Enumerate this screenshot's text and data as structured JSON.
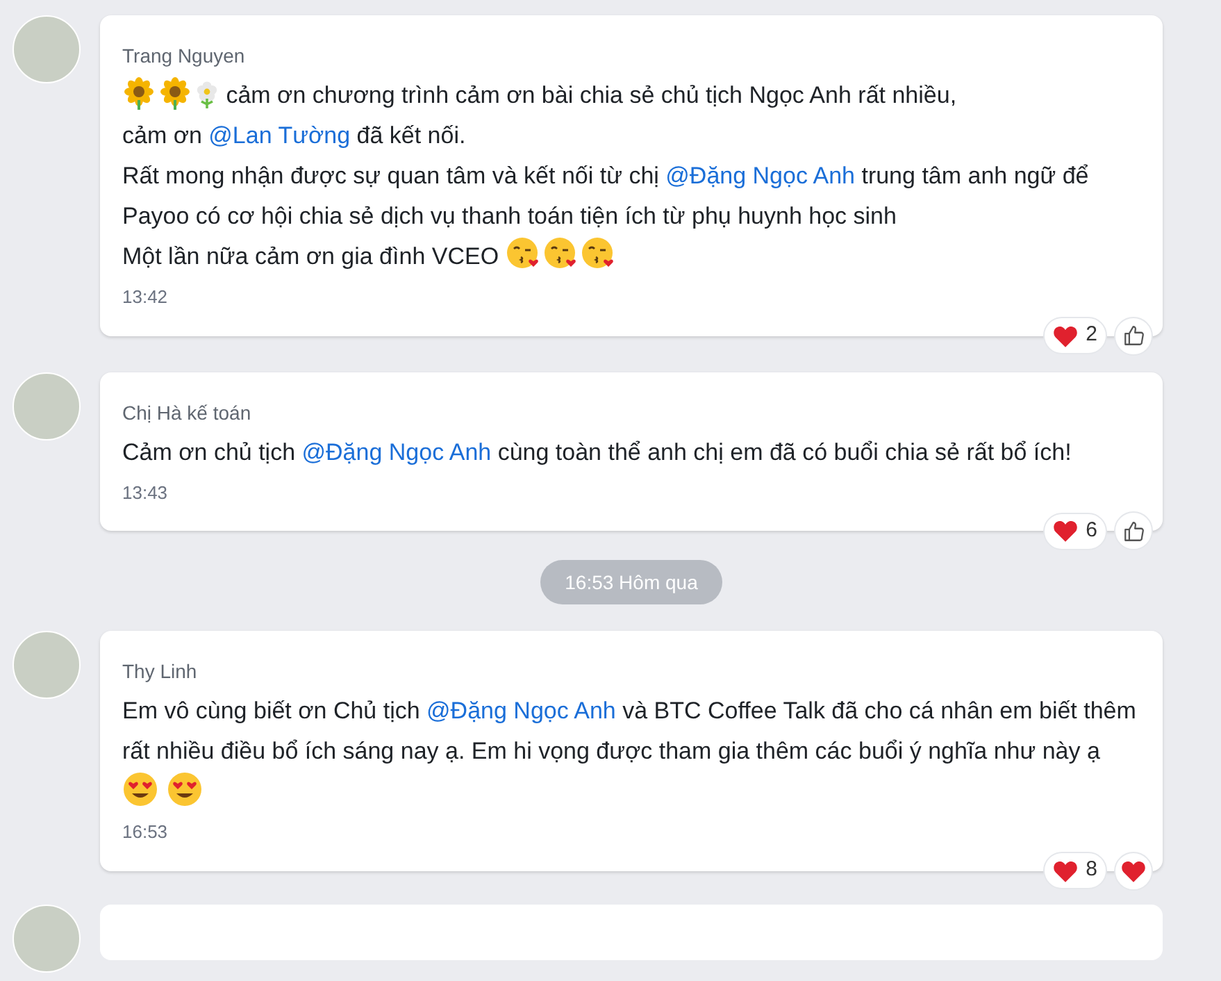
{
  "messages": [
    {
      "kind": "message",
      "author": "Trang Nguyen",
      "time": "13:42",
      "body": [
        {
          "kind": "sunflower"
        },
        {
          "kind": "sunflower"
        },
        {
          "kind": "blossom"
        },
        {
          "kind": "text",
          "text": " cảm ơn chương trình cảm ơn bài chia sẻ chủ tịch Ngọc Anh rất nhiều,"
        },
        {
          "kind": "break"
        },
        {
          "kind": "text",
          "text": "cảm ơn "
        },
        {
          "kind": "mention",
          "text": "@Lan Tường"
        },
        {
          "kind": "text",
          "text": " đã kết nối."
        },
        {
          "kind": "break"
        },
        {
          "kind": "text",
          "text": "Rất mong nhận được sự quan tâm và kết nối từ chị "
        },
        {
          "kind": "mention",
          "text": "@Đặng Ngọc Anh"
        },
        {
          "kind": "text",
          "text": " trung tâm anh ngữ để Payoo có cơ hội chia sẻ dịch vụ thanh toán tiện ích từ phụ huynh học sinh"
        },
        {
          "kind": "break"
        },
        {
          "kind": "text",
          "text": "Một lần nữa cảm ơn gia đình VCEO "
        },
        {
          "kind": "kiss"
        },
        {
          "kind": "kiss"
        },
        {
          "kind": "kiss"
        }
      ],
      "reactions": {
        "count": "2",
        "reacted": false
      }
    },
    {
      "kind": "message",
      "author": "Chị Hà kế toán",
      "time": "13:43",
      "body": [
        {
          "kind": "text",
          "text": "Cảm ơn chủ tịch "
        },
        {
          "kind": "mention",
          "text": "@Đặng Ngọc Anh"
        },
        {
          "kind": "text",
          "text": " cùng toàn thể anh chị em đã có buổi chia sẻ rất bổ ích!"
        }
      ],
      "reactions": {
        "count": "6",
        "reacted": false
      }
    },
    {
      "kind": "divider",
      "text": "16:53 Hôm qua"
    },
    {
      "kind": "message",
      "author": "Thy Linh",
      "time": "16:53",
      "body": [
        {
          "kind": "text",
          "text": "Em vô cùng biết ơn Chủ tịch "
        },
        {
          "kind": "mention",
          "text": "@Đặng Ngọc Anh"
        },
        {
          "kind": "text",
          "text": " và BTC Coffee Talk đã cho cá nhân em biết thêm rất nhiều điều bổ ích sáng nay ạ. Em hi vọng được tham gia thêm các buổi ý nghĩa như này ạ "
        },
        {
          "kind": "heart_eyes"
        },
        {
          "kind": "heart_eyes"
        }
      ],
      "reactions": {
        "count": "8",
        "reacted": true
      }
    }
  ]
}
